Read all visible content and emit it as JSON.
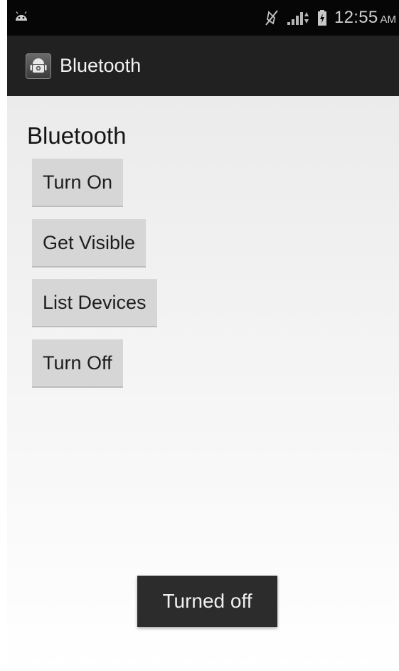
{
  "status_bar": {
    "time": "12:55",
    "ampm": "AM",
    "icons": [
      "android-debug-icon",
      "mute-icon",
      "signal-icon",
      "battery-charging-icon"
    ]
  },
  "action_bar": {
    "title": "Bluetooth",
    "icon": "app-android-icon"
  },
  "main": {
    "heading": "Bluetooth",
    "buttons": [
      {
        "label": "Turn On"
      },
      {
        "label": "Get Visible"
      },
      {
        "label": "List Devices"
      },
      {
        "label": "Turn Off"
      }
    ]
  },
  "toast": {
    "message": "Turned off"
  },
  "colors": {
    "status_bar_bg": "#060606",
    "action_bar_bg": "#212121",
    "button_bg": "#d6d6d6",
    "toast_bg": "#2c2c2c"
  }
}
